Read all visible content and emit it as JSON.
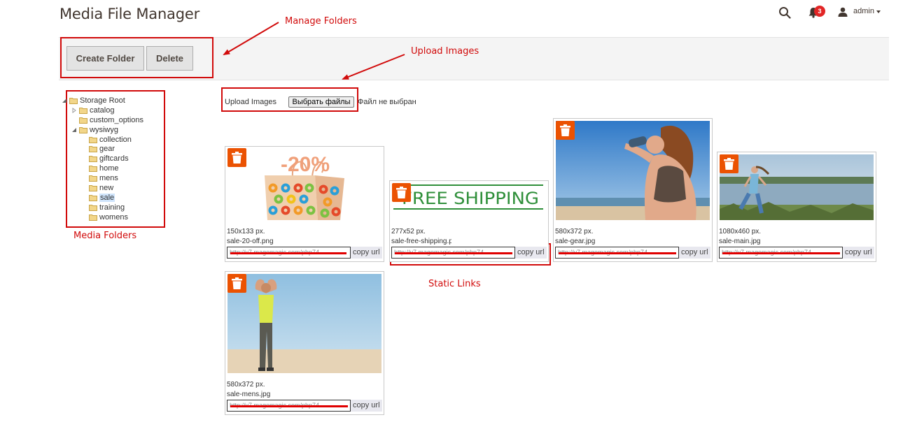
{
  "header": {
    "title": "Media File Manager",
    "notifications_count": "3",
    "user_name": "admin",
    "icons": [
      "search-icon",
      "bell-icon",
      "user-icon",
      "caret-down-icon"
    ]
  },
  "toolbar": {
    "create_folder_label": "Create Folder",
    "delete_label": "Delete"
  },
  "annotations": {
    "manage_folders": "Manage Folders",
    "upload_images": "Upload Images",
    "media_folders": "Media Folders",
    "static_links": "Static Links"
  },
  "folder_tree": {
    "root": "Storage Root",
    "items": [
      {
        "label": "catalog",
        "expanded": false
      },
      {
        "label": "custom_options"
      },
      {
        "label": "wysiwyg",
        "expanded": true
      },
      {
        "label": "collection"
      },
      {
        "label": "gear"
      },
      {
        "label": "giftcards"
      },
      {
        "label": "home"
      },
      {
        "label": "mens"
      },
      {
        "label": "new"
      },
      {
        "label": "sale",
        "selected": true
      },
      {
        "label": "training"
      },
      {
        "label": "womens"
      }
    ]
  },
  "upload": {
    "label": "Upload Images",
    "file_button": "Выбрать файлы",
    "no_file": "Файл не выбран"
  },
  "images": [
    {
      "dims": "150x133 px.",
      "name": "sale-20-off.png",
      "url": "http://v7.magemagic.com/php74",
      "copy": "copy url"
    },
    {
      "dims": "277x52 px.",
      "name": "sale-free-shipping.p",
      "url": "http://v7.magemagic.com/php74",
      "copy": "copy url"
    },
    {
      "dims": "580x372 px.",
      "name": "sale-gear.jpg",
      "url": "http://v7.magemagic.com/php74",
      "copy": "copy url"
    },
    {
      "dims": "1080x460 px.",
      "name": "sale-main.jpg",
      "url": "http://v7.magemagic.com/php74",
      "copy": "copy url"
    },
    {
      "dims": "580x372 px.",
      "name": "sale-mens.jpg",
      "url": "http://v7.magemagic.com/php74",
      "copy": "copy url"
    }
  ],
  "thumbnails": {
    "sale_badge": "-20%",
    "free_shipping": "FREE SHIPPING"
  },
  "colors": {
    "annotation_red": "#d10a0a",
    "trash_orange": "#eb5202",
    "badge_red": "#e22626",
    "selection_blue": "#cfe4fb"
  }
}
